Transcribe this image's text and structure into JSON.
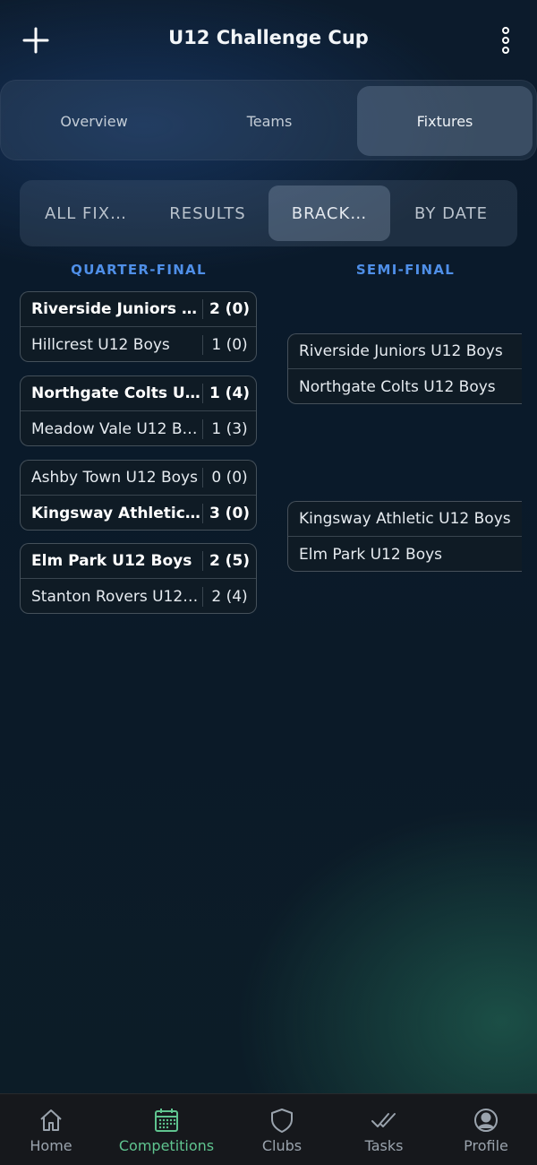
{
  "header": {
    "title": "U12 Challenge Cup"
  },
  "top_tabs": [
    {
      "label": "Overview"
    },
    {
      "label": "Teams"
    },
    {
      "label": "Fixtures",
      "selected": true
    }
  ],
  "fixture_views": [
    {
      "label": "ALL FIX…"
    },
    {
      "label": "RESULTS"
    },
    {
      "label": "BRACK…",
      "selected": true
    },
    {
      "label": "BY DATE"
    }
  ],
  "rounds": {
    "quarter_final": {
      "title": "QUARTER-FINAL",
      "matches": [
        {
          "home": {
            "name": "Riverside Juniors U…",
            "score": "2 (0)",
            "winner": true
          },
          "away": {
            "name": "Hillcrest U12 Boys",
            "score": "1 (0)",
            "winner": false
          }
        },
        {
          "home": {
            "name": "Northgate Colts U1…",
            "score": "1 (4)",
            "winner": true
          },
          "away": {
            "name": "Meadow Vale U12 Bo…",
            "score": "1 (3)",
            "winner": false
          }
        },
        {
          "home": {
            "name": "Ashby Town U12 Boys",
            "score": "0 (0)",
            "winner": false
          },
          "away": {
            "name": "Kingsway Athletic …",
            "score": "3 (0)",
            "winner": true
          }
        },
        {
          "home": {
            "name": "Elm Park U12 Boys",
            "score": "2 (5)",
            "winner": true
          },
          "away": {
            "name": "Stanton Rovers U12 …",
            "score": "2 (4)",
            "winner": false
          }
        }
      ]
    },
    "semi_final": {
      "title": "SEMI-FINAL",
      "matches": [
        {
          "home": "Riverside Juniors U12 Boys",
          "away": "Northgate Colts U12 Boys"
        },
        {
          "home": "Kingsway Athletic U12 Boys",
          "away": "Elm Park U12 Boys"
        }
      ]
    }
  },
  "bottom_nav": [
    {
      "label": "Home",
      "icon": "home-icon"
    },
    {
      "label": "Competitions",
      "icon": "calendar-icon",
      "active": true
    },
    {
      "label": "Clubs",
      "icon": "shield-icon"
    },
    {
      "label": "Tasks",
      "icon": "double-check-icon"
    },
    {
      "label": "Profile",
      "icon": "user-circle-icon"
    }
  ],
  "colors": {
    "accent_blue": "#4f8fe8",
    "active_nav": "#5fc48f"
  }
}
